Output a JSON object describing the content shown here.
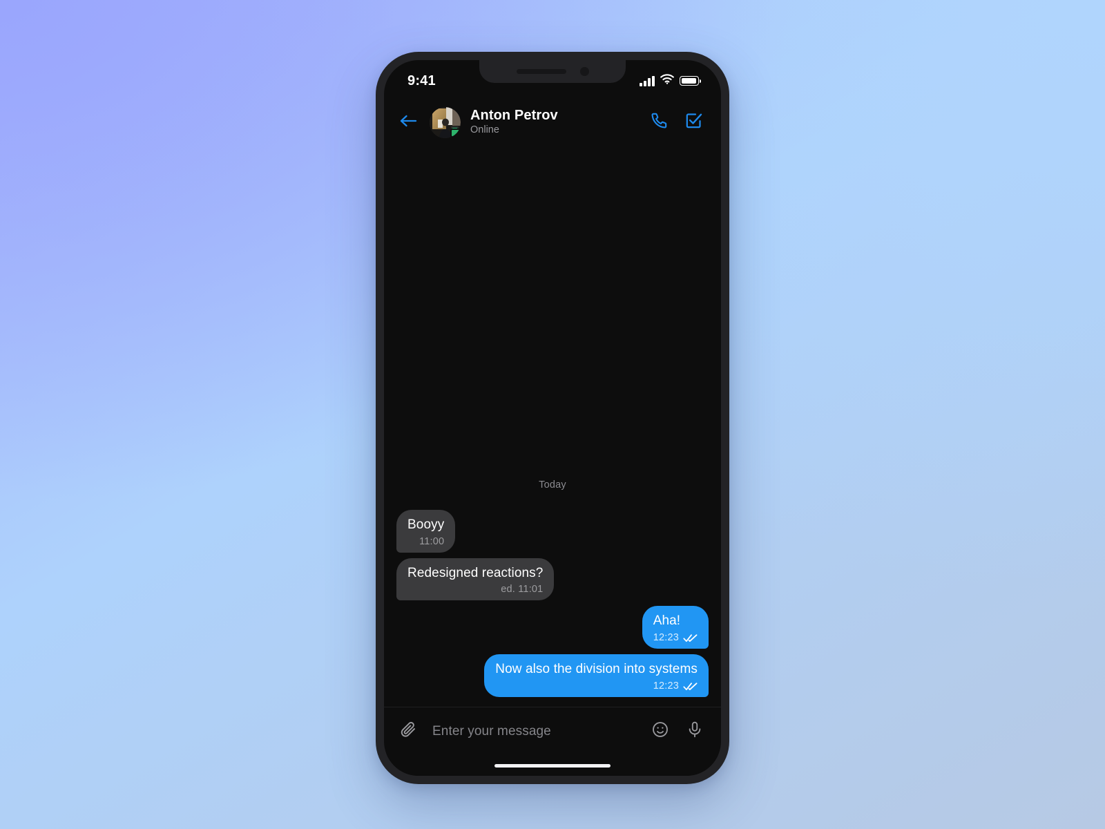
{
  "theme": {
    "accent": "#2196f3",
    "bubble_in_bg": "#3b3b3d",
    "bubble_out_bg": "#2196f3",
    "screen_bg": "#0d0d0d",
    "frame_color": "#232326",
    "online_dot": "#2db36b",
    "wallpaper_from": "#9aa6fd",
    "wallpaper_to": "#b6c9e4"
  },
  "status_bar": {
    "time": "9:41",
    "signal_icon": "cellular-signal-icon",
    "wifi_icon": "wifi-icon",
    "battery_icon": "battery-icon"
  },
  "header": {
    "back_icon": "back-arrow-icon",
    "avatar_alt": "Anton Petrov avatar",
    "name": "Anton Petrov",
    "status": "Online",
    "call_icon": "phone-call-icon",
    "compose_icon": "checkbox-edit-icon"
  },
  "conversation": {
    "day_divider": "Today",
    "messages": [
      {
        "direction": "in",
        "text": "Booyy",
        "time": "11:00",
        "edited": false,
        "read": false
      },
      {
        "direction": "in",
        "text": "Redesigned reactions?",
        "time": "ed. 11:01",
        "edited": true,
        "read": false
      },
      {
        "direction": "out",
        "text": "Aha!",
        "time": "12:23",
        "edited": false,
        "read": true
      },
      {
        "direction": "out",
        "text": "Now also the division into systems",
        "time": "12:23",
        "edited": false,
        "read": true
      }
    ]
  },
  "input_bar": {
    "attach_icon": "paperclip-icon",
    "placeholder": "Enter your message",
    "value": "",
    "emoji_icon": "smiley-face-icon",
    "mic_icon": "microphone-icon"
  }
}
